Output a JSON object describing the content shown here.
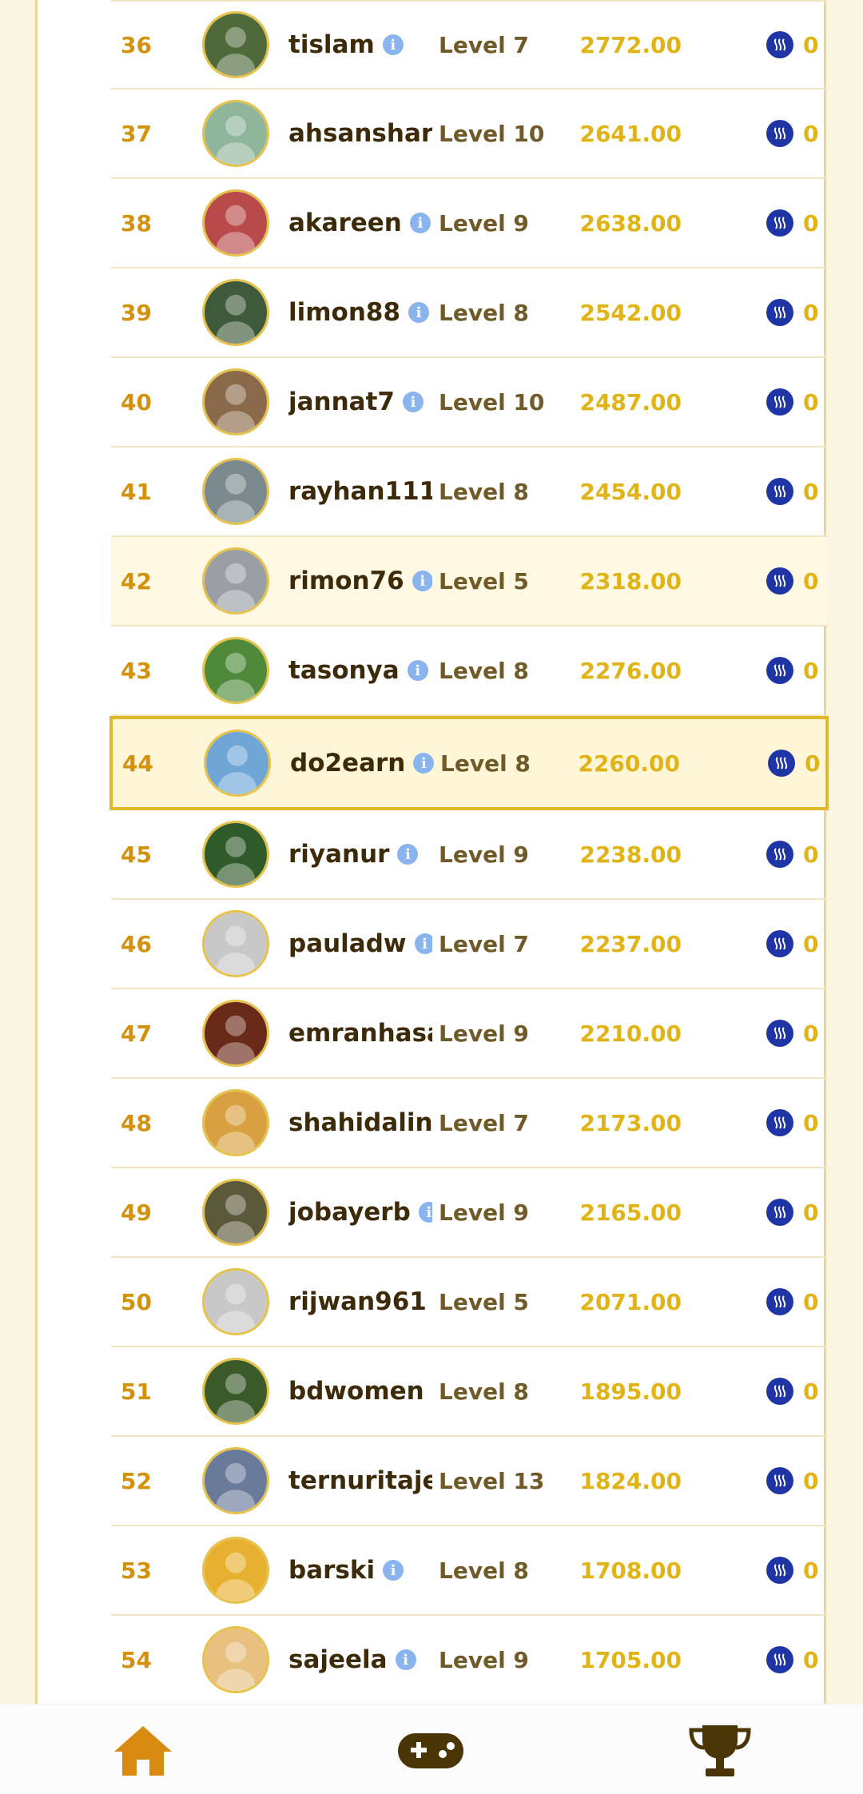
{
  "leaderboard": {
    "rows": [
      {
        "rank": "36",
        "name": "tislam",
        "level": "Level 7",
        "score": "2772.00",
        "reward": "0",
        "avatar_color": "#4f6a3a"
      },
      {
        "rank": "37",
        "name": "ahsanshari",
        "level": "Level 10",
        "score": "2641.00",
        "reward": "0",
        "avatar_color": "#8fb59b"
      },
      {
        "rank": "38",
        "name": "akareen",
        "level": "Level 9",
        "score": "2638.00",
        "reward": "0",
        "avatar_color": "#b84a4a"
      },
      {
        "rank": "39",
        "name": "limon88",
        "level": "Level 8",
        "score": "2542.00",
        "reward": "0",
        "avatar_color": "#3f5a3a"
      },
      {
        "rank": "40",
        "name": "jannat7",
        "level": "Level 10",
        "score": "2487.00",
        "reward": "0",
        "avatar_color": "#8a6a4a"
      },
      {
        "rank": "41",
        "name": "rayhan111",
        "level": "Level 8",
        "score": "2454.00",
        "reward": "0",
        "avatar_color": "#7a8a8e"
      },
      {
        "rank": "42",
        "name": "rimon76",
        "level": "Level 5",
        "score": "2318.00",
        "reward": "0",
        "avatar_color": "#9a9fa5"
      },
      {
        "rank": "43",
        "name": "tasonya",
        "level": "Level 8",
        "score": "2276.00",
        "reward": "0",
        "avatar_color": "#4e8a3a"
      },
      {
        "rank": "44",
        "name": "do2earn",
        "level": "Level 8",
        "score": "2260.00",
        "reward": "0",
        "avatar_color": "#6fa6d6"
      },
      {
        "rank": "45",
        "name": "riyanur",
        "level": "Level 9",
        "score": "2238.00",
        "reward": "0",
        "avatar_color": "#2f5a2a"
      },
      {
        "rank": "46",
        "name": "pauladw",
        "level": "Level 7",
        "score": "2237.00",
        "reward": "0",
        "avatar_color": "#c8c8c8"
      },
      {
        "rank": "47",
        "name": "emranhasa",
        "level": "Level 9",
        "score": "2210.00",
        "reward": "0",
        "avatar_color": "#6a2a1a"
      },
      {
        "rank": "48",
        "name": "shahidalina",
        "level": "Level 7",
        "score": "2173.00",
        "reward": "0",
        "avatar_color": "#d8a040"
      },
      {
        "rank": "49",
        "name": "jobayerb",
        "level": "Level 9",
        "score": "2165.00",
        "reward": "0",
        "avatar_color": "#5a5a3a"
      },
      {
        "rank": "50",
        "name": "rijwan961",
        "level": "Level 5",
        "score": "2071.00",
        "reward": "0",
        "avatar_color": "#c8c8c8"
      },
      {
        "rank": "51",
        "name": "bdwomen",
        "level": "Level 8",
        "score": "1895.00",
        "reward": "0",
        "avatar_color": "#3a5a2a"
      },
      {
        "rank": "52",
        "name": "ternuritajes",
        "level": "Level 13",
        "score": "1824.00",
        "reward": "0",
        "avatar_color": "#6a7a9a"
      },
      {
        "rank": "53",
        "name": "barski",
        "level": "Level 8",
        "score": "1708.00",
        "reward": "0",
        "avatar_color": "#e8b030"
      },
      {
        "rank": "54",
        "name": "sajeela",
        "level": "Level 9",
        "score": "1705.00",
        "reward": "0",
        "avatar_color": "#e8c080"
      }
    ]
  },
  "nav": {
    "items": [
      {
        "name": "home-icon"
      },
      {
        "name": "gamepad-icon"
      },
      {
        "name": "trophy-icon"
      }
    ]
  },
  "colors": {
    "accent": "#e0b418",
    "rank": "#d4920a",
    "coin": "#1f35a6",
    "nav_home": "#d98a10",
    "nav_dark": "#4a3506"
  }
}
